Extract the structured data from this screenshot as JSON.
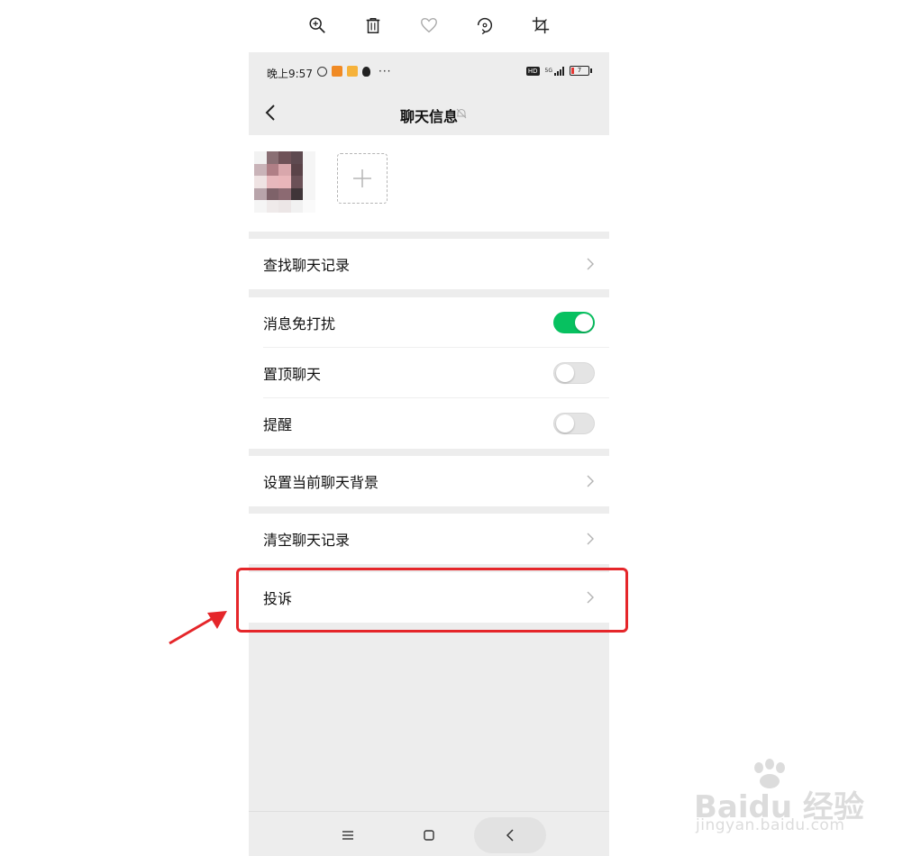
{
  "viewer_toolbar": {
    "icons": [
      "zoom-in-icon",
      "trash-icon",
      "heart-icon",
      "rotate-icon",
      "crop-icon"
    ]
  },
  "status_bar": {
    "time": "晚上9:57",
    "dots": "···",
    "network": "5G",
    "hd": "HD",
    "battery": "7"
  },
  "header": {
    "title": "聊天信息"
  },
  "menu": {
    "search_history": "查找聊天记录",
    "mute": "消息免打扰",
    "pin": "置顶聊天",
    "remind": "提醒",
    "background": "设置当前聊天背景",
    "clear_history": "清空聊天记录",
    "report": "投诉"
  },
  "toggles": {
    "mute": true,
    "pin": false,
    "remind": false
  },
  "colors": {
    "toggle_on": "#07c160",
    "annotation": "#e5262a",
    "page_bg": "#ededed"
  },
  "watermark": {
    "main": "Baidu 经验",
    "sub": "jingyan.baidu.com"
  }
}
